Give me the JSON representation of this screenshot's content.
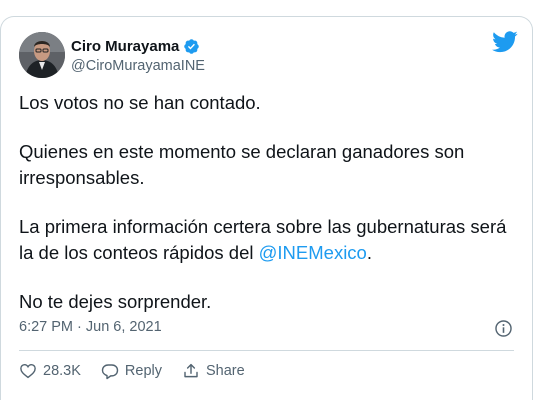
{
  "tweet": {
    "author_name": "Ciro Murayama",
    "handle": "@CiroMurayamaINE",
    "paragraphs": [
      "Los votos no se han contado.",
      "Quienes en este momento se declaran ganadores son irresponsables."
    ],
    "p3_text": "La primera información certera sobre las gubernaturas será la de los conteos rápidos del ",
    "mention": "@INEMexico",
    "p3_suffix": ".",
    "p4": "No te dejes sorprender.",
    "timestamp": "6:27 PM · Jun 6, 2021",
    "likes": "28.3K",
    "reply_label": "Reply",
    "share_label": "Share"
  },
  "colors": {
    "accent": "#1d9bf0",
    "text": "#0f1419",
    "muted": "#536471",
    "border": "#cfd9de"
  },
  "icons": {
    "avatar": "avatar",
    "verified": "verified-badge-icon",
    "logo": "twitter-bird-icon",
    "info": "info-icon",
    "like": "heart-icon",
    "reply": "reply-bubble-icon",
    "share": "share-icon"
  }
}
